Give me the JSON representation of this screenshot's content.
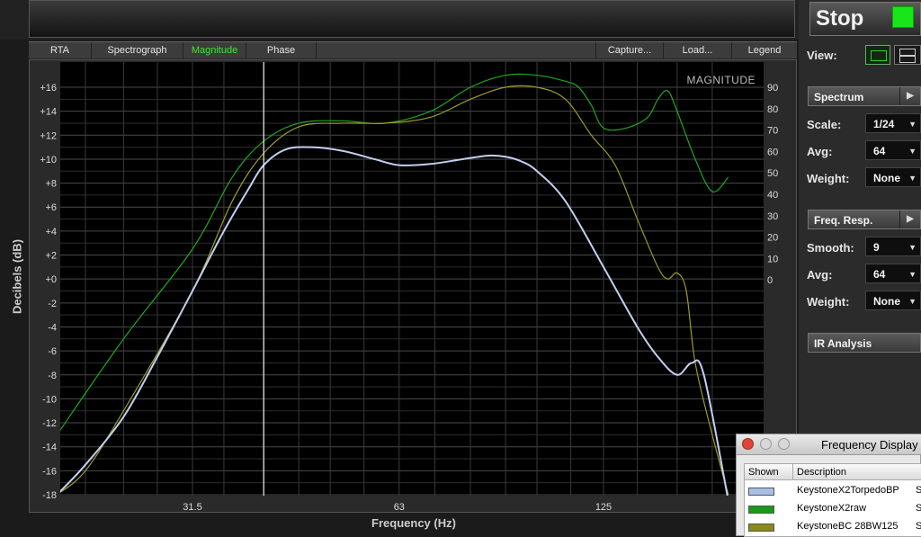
{
  "toolbar": {
    "left_buttons": [
      "RTA",
      "Spectrograph",
      "Magnitude",
      "Phase"
    ],
    "active": "Magnitude",
    "right_buttons": [
      "Capture...",
      "Load...",
      "Legend"
    ]
  },
  "chart_data": {
    "type": "line",
    "title": "MAGNITUDE",
    "xlabel": "Frequency (Hz)",
    "ylabel": "Decibels (dB)",
    "x_scale": "log",
    "x_ticks": [
      "31.5",
      "63",
      "125"
    ],
    "ylim": [
      -18,
      17
    ],
    "y_ticks": [
      "+16",
      "+14",
      "+12",
      "+10",
      "+8",
      "+6",
      "+4",
      "+2",
      "+0",
      "-2",
      "-4",
      "-6",
      "-8",
      "-10",
      "-12",
      "-14",
      "-16",
      "-18"
    ],
    "y2_ticks": [
      "90",
      "80",
      "70",
      "60",
      "50",
      "40",
      "30",
      "20",
      "10",
      "0"
    ],
    "cursor_x": 40,
    "grid": true,
    "series": [
      {
        "name": "KeystoneX2TorpedoBP",
        "color": "#c0d0f0",
        "x": [
          20,
          22,
          25,
          28,
          31.5,
          35,
          38,
          40,
          43,
          47,
          52,
          58,
          63,
          70,
          78,
          85,
          90,
          95,
          100,
          110,
          125,
          140,
          150,
          160,
          168,
          175,
          190
        ],
        "y": [
          -18,
          -15.5,
          -11.5,
          -6.5,
          -1,
          4,
          7.5,
          9.5,
          10.8,
          11,
          10.7,
          10,
          9.5,
          9.6,
          10,
          10.3,
          10.2,
          9.8,
          9,
          6.5,
          1,
          -4,
          -6.5,
          -8,
          -7,
          -8,
          -18.5
        ]
      },
      {
        "name": "KeystoneX2raw",
        "color": "#1fa81f",
        "x": [
          20,
          25,
          31.5,
          36,
          40,
          45,
          52,
          60,
          70,
          80,
          90,
          100,
          110,
          115,
          120,
          125,
          135,
          145,
          150,
          155,
          160,
          170,
          180,
          190
        ],
        "y": [
          -13,
          -5,
          2.5,
          8.5,
          11.5,
          13,
          13.2,
          13,
          14,
          16,
          17,
          17,
          16.5,
          16,
          14.5,
          12.6,
          12.6,
          13.5,
          15,
          15.7,
          14,
          10,
          7.3,
          8.5
        ]
      },
      {
        "name": "KeystoneBC 28BW125",
        "color": "#9c9c2a",
        "x": [
          20,
          22,
          25,
          31.5,
          36,
          40,
          45,
          52,
          60,
          70,
          80,
          90,
          100,
          110,
          120,
          130,
          140,
          150,
          155,
          160,
          165,
          170,
          180,
          190
        ],
        "y": [
          -18,
          -16,
          -11,
          -1,
          6.5,
          10.5,
          12.7,
          13,
          13,
          13.5,
          15,
          16,
          16,
          15,
          12,
          9.5,
          5,
          1,
          0,
          0.5,
          -1,
          -7,
          -13,
          -18
        ]
      }
    ]
  },
  "panel": {
    "stop_label": "Stop",
    "stop_indicator_color": "#19e619",
    "view_label": "View:",
    "spectrum": {
      "title": "Spectrum",
      "scale_label": "Scale:",
      "scale_value": "1/24",
      "avg_label": "Avg:",
      "avg_value": "64",
      "weight_label": "Weight:",
      "weight_value": "None"
    },
    "freq_resp": {
      "title": "Freq. Resp.",
      "smooth_label": "Smooth:",
      "smooth_value": "9",
      "avg_label": "Avg:",
      "avg_value": "64",
      "weight_label": "Weight:",
      "weight_value": "None"
    },
    "ir": {
      "title": "IR Analysis"
    }
  },
  "legend_window": {
    "title": "Frequency Display",
    "col_shown": "Shown",
    "col_description": "Description",
    "rows": [
      {
        "description": "KeystoneX2TorpedoBP",
        "color": "#a8c0e8",
        "extra": "S"
      },
      {
        "description": "KeystoneX2raw",
        "color": "#1a9a1a",
        "extra": "S"
      },
      {
        "description": "KeystoneBC 28BW125",
        "color": "#8a8a1a",
        "extra": "S"
      }
    ]
  }
}
